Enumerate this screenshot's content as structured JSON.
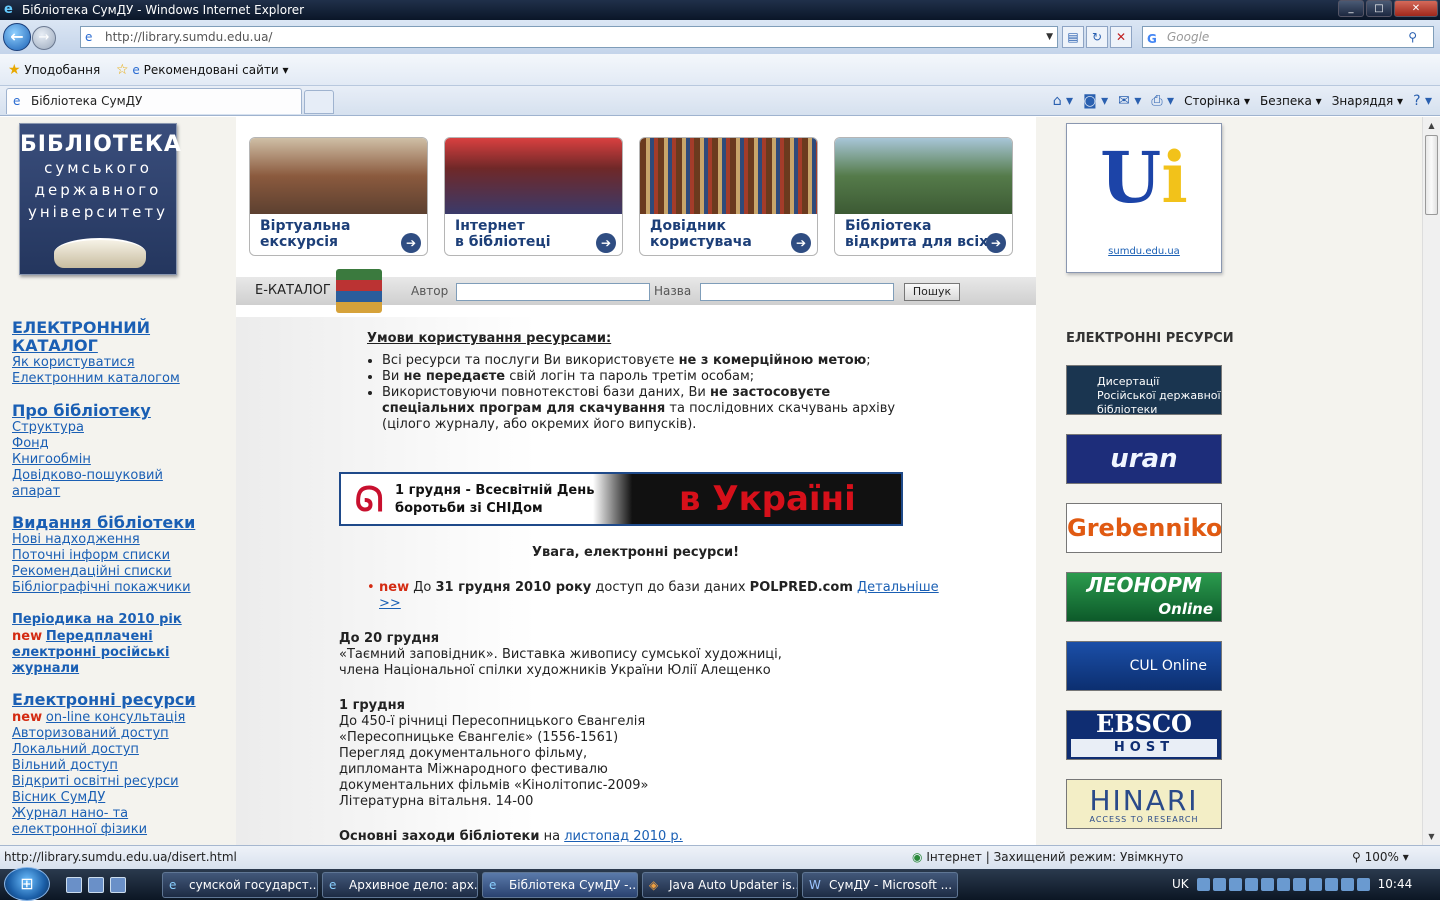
{
  "window": {
    "title": "Бібліотека СумДУ - Windows Internet Explorer"
  },
  "nav": {
    "url": "http://library.sumdu.edu.ua/",
    "search_placeholder": "Google"
  },
  "favbar": {
    "favorites": "Уподобання",
    "recommended": "Рекомендовані сайти"
  },
  "tab": {
    "label": "Бібліотека СумДУ"
  },
  "cmdbar": {
    "page": "Сторінка",
    "safety": "Безпека",
    "tools": "Знаряддя"
  },
  "logo": {
    "line1": "БІБЛІОТЕКА",
    "line2": "сумського",
    "line3": "державного",
    "line4": "університету"
  },
  "menu": {
    "catalog_head": "ЕЛЕКТРОННИЙ КАТАЛОГ",
    "catalog_links": [
      "Як користуватися",
      "Електронним каталогом"
    ],
    "about_head": "Про бібліотеку",
    "about_links": [
      "Структура",
      "Фонд",
      "Книгообмін",
      "Довідково-пошуковий",
      "апарат"
    ],
    "editions_head": "Видання бібліотеки",
    "editions_links": [
      "Нові надходження",
      "Поточні інформ списки",
      "Рекомендаційні списки",
      "Бібліографічні покажчики"
    ],
    "periodicals": "Періодика на 2010 рік",
    "new_label": "new",
    "prepaid": [
      "Передплачені",
      "електронні російські",
      "журнали"
    ],
    "eres_head": "Електронні ресурси",
    "eres_links": [
      "on-line консультація",
      "Авторизований доступ",
      "Локальний доступ",
      "Вільний доступ",
      "Відкриті освітні ресурси",
      "Вісник СумДУ",
      "Журнал нано- та",
      "електронної фізики"
    ]
  },
  "tiles": [
    {
      "line1": "Віртуальна",
      "line2": "екскурсія"
    },
    {
      "line1": "Інтернет",
      "line2": "в бібліотеці"
    },
    {
      "line1": "Довідник",
      "line2": "користувача"
    },
    {
      "line1": "Бібліотека",
      "line2": "відкрита для всіх"
    }
  ],
  "ecat": {
    "label": "Е-КАТАЛОГ",
    "author": "Автор",
    "title": "Назва",
    "search_btn": "Пошук"
  },
  "terms": {
    "title": "Умови користування ресурсами:",
    "i1a": "Всі ресурси та послуги Ви використовуєте ",
    "i1b": "не з комерційною метою",
    "i1c": ";",
    "i2a": "Ви ",
    "i2b": "не передаєте",
    "i2c": " свій логін та пароль третім особам;",
    "i3a": "Використовуючи повнотекстові бази даних, Ви ",
    "i3b": "не застосовуєте спеціальних програм для скачування",
    "i3c": " та послідовних скачувань архіву (цілого журналу, або окремих його випусків)."
  },
  "banner": {
    "line1": "1 грудня - Всесвітній День",
    "line2": "боротьби зі СНІДом",
    "big": "в Україні"
  },
  "attention": "Увага, електронні ресурси!",
  "news": {
    "new": "new",
    "pre": " До ",
    "date": "31 грудня 2010 року",
    "mid": " доступ до бази даних ",
    "db": "POLPRED.com",
    "more": "Детальніше",
    "arrows": ">>"
  },
  "event1": {
    "date": "До 20 грудня",
    "l1": "«Таємний заповідник». Виставка живопису сумської художниці,",
    "l2": "члена Національної спілки художників України Юлії Алещенко"
  },
  "event2": {
    "date": "1 грудня",
    "l1": "До 450-ї річниці Пересопницького Євангелія",
    "l2": "«Пересопницьке Євангеліє» (1556-1561)",
    "l3": "Перегляд документального фільму,",
    "l4": "дипломанта Міжнародного фестивалю",
    "l5": "документальних фільмів «Кінолітопис-2009»",
    "l6": "Літературна вітальня. 14-00"
  },
  "basic": {
    "bold": "Основні заходи бібліотеки",
    "mid": " на ",
    "link": "листопад 2010 р."
  },
  "right": {
    "sumdu_link": "sumdu.edu.ua",
    "heading": "ЕЛЕКТРОННІ РЕСУРСИ",
    "dissert": "Дисертації Російської державної біблiотеки",
    "uran": "uran",
    "greb1": "Grebenni",
    "greb2": "kon",
    "leonorm": "ЛЕОНОРМ",
    "online": "Online",
    "cul": "CUL Online",
    "ebsco": "EBSCO",
    "host": "HOST",
    "hinari": "HINARI",
    "hinari_sub": "ACCESS TO RESEARCH"
  },
  "status": {
    "url": "http://library.sumdu.edu.ua/disert.html",
    "zone": "Інтернет | Захищений режим: Увімкнуто",
    "zoom": "100%"
  },
  "taskbar": {
    "items": [
      "сумской государст...",
      "Архивное дело: арх...",
      "Бібліотека СумДУ -...",
      "Java Auto Updater is...",
      "СумДУ - Microsoft ..."
    ],
    "lang": "UK",
    "time": "10:44"
  }
}
